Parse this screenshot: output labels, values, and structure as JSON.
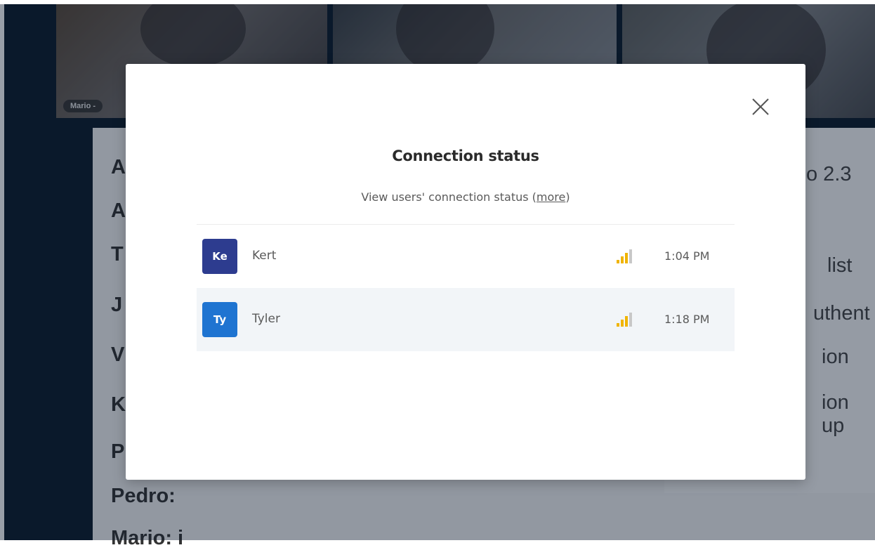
{
  "background": {
    "video_tiles": [
      {
        "label": "Mario -"
      },
      {
        "label": ""
      },
      {
        "label": ""
      }
    ],
    "transcript_lines": [
      "A",
      "A",
      "T",
      "J",
      "V",
      "K",
      "P",
      "Pedro:",
      "Mario: i"
    ],
    "side_panel_lines": [
      "o 2.3",
      "list",
      "uthent",
      "ion",
      "ion up"
    ]
  },
  "modal": {
    "title": "Connection status",
    "subtitle_prefix": "View users' connection status ",
    "subtitle_open_paren": "(",
    "more_link": "more",
    "subtitle_close_paren": ")",
    "close_icon": "close-icon"
  },
  "users": [
    {
      "initials": "Ke",
      "name": "Kert",
      "time": "1:04 PM",
      "avatar_color": "#2d3c8f",
      "signal_bars_active": 3,
      "signal_bars_total": 4
    },
    {
      "initials": "Ty",
      "name": "Tyler",
      "time": "1:18 PM",
      "avatar_color": "#1f74d1",
      "signal_bars_active": 3,
      "signal_bars_total": 4
    }
  ],
  "colors": {
    "signal_active": "#f0b400",
    "signal_inactive": "#c8c8c8",
    "row_highlight": "#f2f5f8"
  }
}
